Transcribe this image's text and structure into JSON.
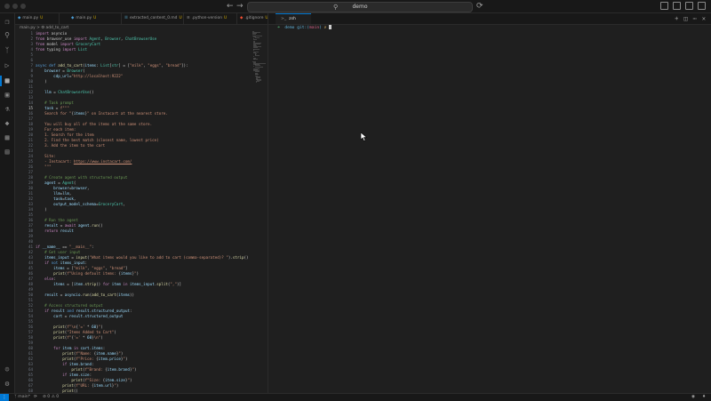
{
  "window": {
    "search_text": "demo"
  },
  "tabs": [
    {
      "label": "main.py",
      "badge": "U",
      "kind": "py",
      "active": false
    },
    {
      "label": "main.py",
      "badge": "U",
      "kind": "py",
      "active": false
    },
    {
      "label": "extracted_content_0.md",
      "badge": "U",
      "kind": "md",
      "active": false
    },
    {
      "label": ".python-version",
      "badge": "U",
      "kind": "txt",
      "active": false
    },
    {
      "label": ".gitignore",
      "badge": "U",
      "kind": "git",
      "active": false
    }
  ],
  "breadcrumb": "main.py > ⚙ add_to_cart",
  "terminal": {
    "tab_label": "zsh",
    "prompt_arrow": "➜",
    "prompt_dir": "demo",
    "prompt_git_open": "git:(",
    "prompt_branch": "main",
    "prompt_git_close": ")",
    "prompt_x": "✗"
  },
  "statusbar": {
    "branch": "main*",
    "errors": "⊘ 0",
    "warnings": "⚠ 0"
  },
  "code_lines": [
    {
      "n": "1",
      "h": "<span class='k'>import</span> asyncio"
    },
    {
      "n": "2",
      "h": "<span class='k'>from</span> browser_use <span class='k'>import</span> <span class='cls'>Agent</span>, <span class='cls'>Browser</span>, <span class='cls'>ChatBrowserUse</span>"
    },
    {
      "n": "3",
      "h": "<span class='k'>from</span> model <span class='k'>import</span> <span class='cls'>GroceryCart</span>"
    },
    {
      "n": "4",
      "h": "<span class='k'>from</span> typing <span class='k'>import</span> <span class='cls'>List</span>"
    },
    {
      "n": "5",
      "h": ""
    },
    {
      "n": "6",
      "h": ""
    },
    {
      "n": "7",
      "h": "<span class='kw'>async</span> <span class='kw'>def</span> <span class='f'>add_to_cart</span>(<span class='v'>items</span>: <span class='cls'>List</span>[<span class='cls'>str</span>] = [<span class='s'>\"milk\"</span>, <span class='s'>\"eggs\"</span>, <span class='s'>\"bread\"</span>]):"
    },
    {
      "n": "8",
      "h": "    <span class='v'>browser</span> = <span class='cls'>Browser</span>("
    },
    {
      "n": "9",
      "h": "        <span class='v'>cdp_url</span>=<span class='s'>\"http://localhost:9222\"</span>"
    },
    {
      "n": "10",
      "h": "    )"
    },
    {
      "n": "11",
      "h": ""
    },
    {
      "n": "12",
      "h": "    <span class='v'>llm</span> = <span class='cls'>ChatBrowserUse</span>()"
    },
    {
      "n": "13",
      "h": ""
    },
    {
      "n": "14",
      "h": "    <span class='c'># Task prompt</span>"
    },
    {
      "n": "15",
      "h": "    <span class='v'>task</span> = <span class='s'>f\"\"\"</span>",
      "cur": true
    },
    {
      "n": "16",
      "h": "<span class='s'>    Search for \"</span>{<span class='v'>items</span>}<span class='s'>\" on Instacart at the nearest store.</span>"
    },
    {
      "n": "17",
      "h": ""
    },
    {
      "n": "18",
      "h": "<span class='s'>    You will buy all of the items at the same store.</span>"
    },
    {
      "n": "19",
      "h": "<span class='s'>    For each item:</span>"
    },
    {
      "n": "20",
      "h": "<span class='s'>    1. Search for the item</span>"
    },
    {
      "n": "21",
      "h": "<span class='s'>    2. Find the best match (closest name, lowest price)</span>"
    },
    {
      "n": "22",
      "h": "<span class='s'>    3. Add the item to the cart</span>"
    },
    {
      "n": "23",
      "h": ""
    },
    {
      "n": "24",
      "h": "<span class='s'>    Site:</span>"
    },
    {
      "n": "25",
      "h": "<span class='s'>    - Instacart: </span><span class='u'>https://www.instacart.com/</span>"
    },
    {
      "n": "26",
      "h": "<span class='s'>    \"\"\"</span>"
    },
    {
      "n": "27",
      "h": ""
    },
    {
      "n": "28",
      "h": "    <span class='c'># Create agent with structured output</span>"
    },
    {
      "n": "29",
      "h": "    <span class='v'>agent</span> = <span class='cls'>Agent</span>("
    },
    {
      "n": "30",
      "h": "        <span class='v'>browser</span>=<span class='v'>browser</span>,"
    },
    {
      "n": "31",
      "h": "        <span class='v'>llm</span>=<span class='v'>llm</span>,"
    },
    {
      "n": "32",
      "h": "        <span class='v'>task</span>=<span class='v'>task</span>,"
    },
    {
      "n": "33",
      "h": "        <span class='v'>output_model_schema</span>=<span class='cls'>GroceryCart</span>,"
    },
    {
      "n": "34",
      "h": "    )"
    },
    {
      "n": "35",
      "h": ""
    },
    {
      "n": "36",
      "h": "    <span class='c'># Run the agent</span>"
    },
    {
      "n": "37",
      "h": "    <span class='v'>result</span> = <span class='k'>await</span> <span class='v'>agent</span>.<span class='f'>run</span>()"
    },
    {
      "n": "38",
      "h": "    <span class='k'>return</span> <span class='v'>result</span>"
    },
    {
      "n": "39",
      "h": ""
    },
    {
      "n": "40",
      "h": ""
    },
    {
      "n": "41",
      "h": "<span class='k'>if</span> <span class='v'>__name__</span> == <span class='s'>\"__main__\"</span>:"
    },
    {
      "n": "42",
      "h": "    <span class='c'># Get user input</span>"
    },
    {
      "n": "43",
      "h": "    <span class='v'>items_input</span> = <span class='f'>input</span>(<span class='s'>\"What items would you like to add to cart (comma-separated)? \"</span>).<span class='f'>strip</span>()"
    },
    {
      "n": "44",
      "h": "    <span class='k'>if</span> <span class='kw'>not</span> <span class='v'>items_input</span>:"
    },
    {
      "n": "45",
      "h": "        <span class='v'>items</span> = [<span class='s'>\"milk\"</span>, <span class='s'>\"eggs\"</span>, <span class='s'>\"bread\"</span>]"
    },
    {
      "n": "46",
      "h": "        <span class='f'>print</span>(<span class='s'>f\"Using default items: </span>{<span class='v'>items</span>}<span class='s'>\"</span>)"
    },
    {
      "n": "47",
      "h": "    <span class='k'>else</span>:"
    },
    {
      "n": "48",
      "h": "        <span class='v'>items</span> = [<span class='v'>item</span>.<span class='f'>strip</span>() <span class='k'>for</span> <span class='v'>item</span> <span class='k'>in</span> <span class='v'>items_input</span>.<span class='f'>split</span>(<span class='s'>\",\"</span>)]"
    },
    {
      "n": "49",
      "h": ""
    },
    {
      "n": "50",
      "h": "    <span class='v'>result</span> = <span class='v'>asyncio</span>.<span class='f'>run</span>(<span class='f'>add_to_cart</span>(<span class='v'>items</span>))"
    },
    {
      "n": "51",
      "h": ""
    },
    {
      "n": "52",
      "h": "    <span class='c'># Access structured output</span>"
    },
    {
      "n": "53",
      "h": "    <span class='k'>if</span> <span class='v'>result</span> <span class='kw'>and</span> <span class='v'>result</span>.<span class='v'>structured_output</span>:"
    },
    {
      "n": "54",
      "h": "        <span class='v'>cart</span> = <span class='v'>result</span>.<span class='v'>structured_output</span>"
    },
    {
      "n": "55",
      "h": ""
    },
    {
      "n": "56",
      "h": "        <span class='f'>print</span>(<span class='s'>f\"\\n</span>{<span class='s'>'='</span> * <span class='v'>60</span>}<span class='s'>\"</span>)"
    },
    {
      "n": "57",
      "h": "        <span class='f'>print</span>(<span class='s'>\"Items Added to Cart\"</span>)"
    },
    {
      "n": "58",
      "h": "        <span class='f'>print</span>(<span class='s'>f\"</span>{<span class='s'>'='</span> * <span class='v'>60</span>}<span class='s'>\\n\"</span>)"
    },
    {
      "n": "59",
      "h": ""
    },
    {
      "n": "60",
      "h": "        <span class='k'>for</span> <span class='v'>item</span> <span class='k'>in</span> <span class='v'>cart</span>.<span class='v'>items</span>:"
    },
    {
      "n": "61",
      "h": "            <span class='f'>print</span>(<span class='s'>f\"Name: </span>{<span class='v'>item</span>.<span class='v'>name</span>}<span class='s'>\"</span>)"
    },
    {
      "n": "62",
      "h": "            <span class='f'>print</span>(<span class='s'>f\"Price: </span>{<span class='v'>item</span>.<span class='v'>price</span>}<span class='s'>\"</span>)"
    },
    {
      "n": "63",
      "h": "            <span class='k'>if</span> <span class='v'>item</span>.<span class='v'>brand</span>:"
    },
    {
      "n": "64",
      "h": "                <span class='f'>print</span>(<span class='s'>f\"Brand: </span>{<span class='v'>item</span>.<span class='v'>brand</span>}<span class='s'>\"</span>)"
    },
    {
      "n": "65",
      "h": "            <span class='k'>if</span> <span class='v'>item</span>.<span class='v'>size</span>:"
    },
    {
      "n": "66",
      "h": "                <span class='f'>print</span>(<span class='s'>f\"Size: </span>{<span class='v'>item</span>.<span class='v'>size</span>}<span class='s'>\"</span>)"
    },
    {
      "n": "67",
      "h": "            <span class='f'>print</span>(<span class='s'>f\"URL: </span>{<span class='v'>item</span>.<span class='v'>url</span>}<span class='s'>\"</span>)"
    },
    {
      "n": "68",
      "h": "            <span class='f'>print</span>()"
    }
  ]
}
